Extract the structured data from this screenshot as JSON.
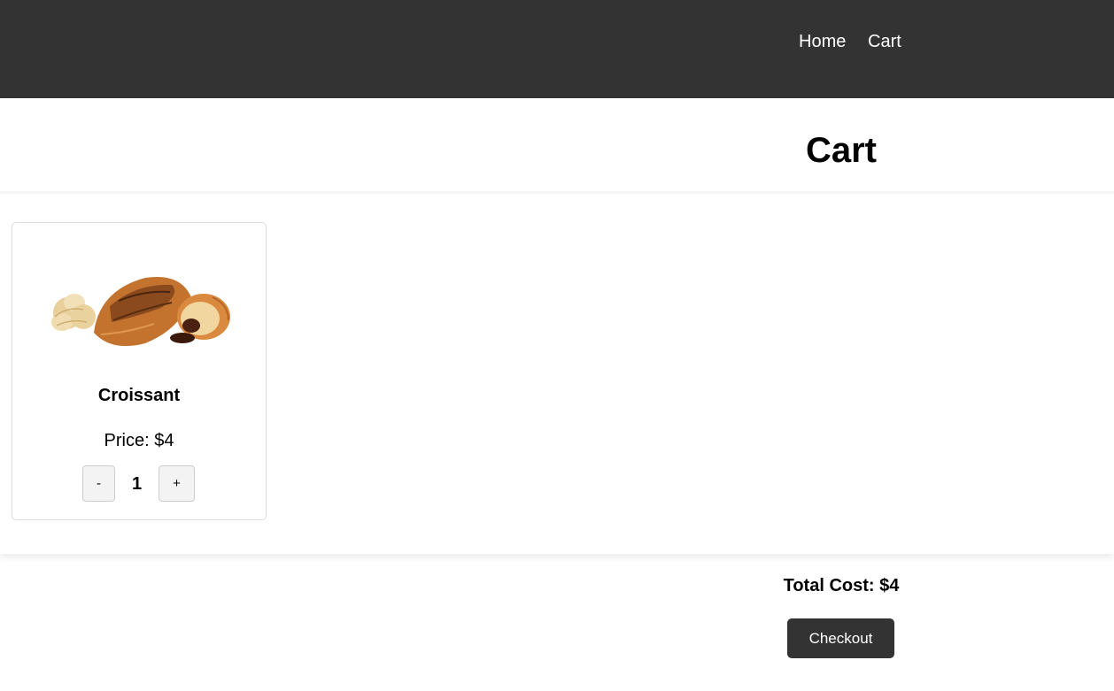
{
  "nav": {
    "home_label": "Home",
    "cart_label": "Cart"
  },
  "page": {
    "title": "Cart"
  },
  "cart": {
    "items": [
      {
        "name": "Croissant",
        "price_text": "Price: $4",
        "quantity": "1",
        "decrement_label": "-",
        "increment_label": "+",
        "image": "croissant-image"
      }
    ],
    "total_text": "Total Cost: $4",
    "checkout_label": "Checkout"
  },
  "colors": {
    "navbar_bg": "#333333",
    "button_bg": "#333333",
    "text_light": "#ffffff"
  }
}
